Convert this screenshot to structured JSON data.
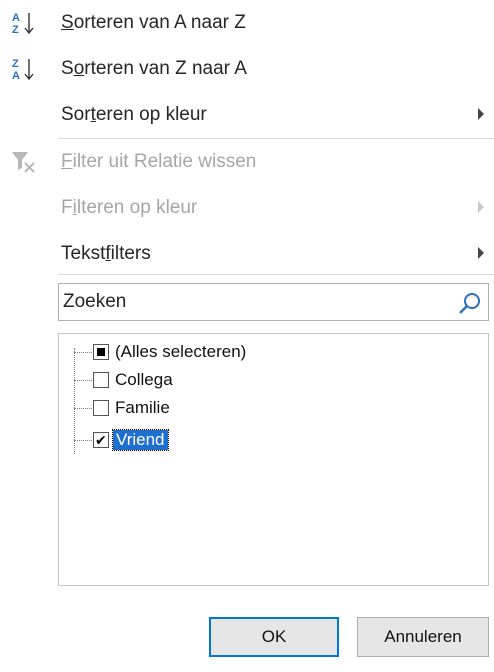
{
  "menu": {
    "sort_az": {
      "pre": "",
      "u": "S",
      "post": "orteren van A naar Z",
      "icon": "sort-ascending-icon"
    },
    "sort_za": {
      "pre": "S",
      "u": "o",
      "post": "rteren van Z naar A",
      "icon": "sort-descending-icon"
    },
    "sort_color": {
      "pre": "Sor",
      "u": "t",
      "post": "eren op kleur"
    },
    "clear_filter": {
      "pre": "",
      "u": "F",
      "post": "ilter uit Relatie wissen",
      "icon": "clear-filter-icon"
    },
    "filter_color": {
      "pre": "F",
      "u": "i",
      "post": "lteren op kleur"
    },
    "text_filters": {
      "pre": "Tekst",
      "u": "f",
      "post": "ilters"
    }
  },
  "search": {
    "value": "Zoeken",
    "icon": "search-icon"
  },
  "list": {
    "items": [
      {
        "label": "(Alles selecteren)",
        "state": "partial"
      },
      {
        "label": "Collega",
        "state": "unchecked"
      },
      {
        "label": "Familie",
        "state": "unchecked"
      },
      {
        "label": "Vriend",
        "state": "checked",
        "check": "✔"
      }
    ]
  },
  "buttons": {
    "ok": "OK",
    "cancel": "Annuleren"
  },
  "colors": {
    "accent": "#0078d7",
    "selection": "#1f6fd1",
    "disabled": "#a6a6a6"
  }
}
